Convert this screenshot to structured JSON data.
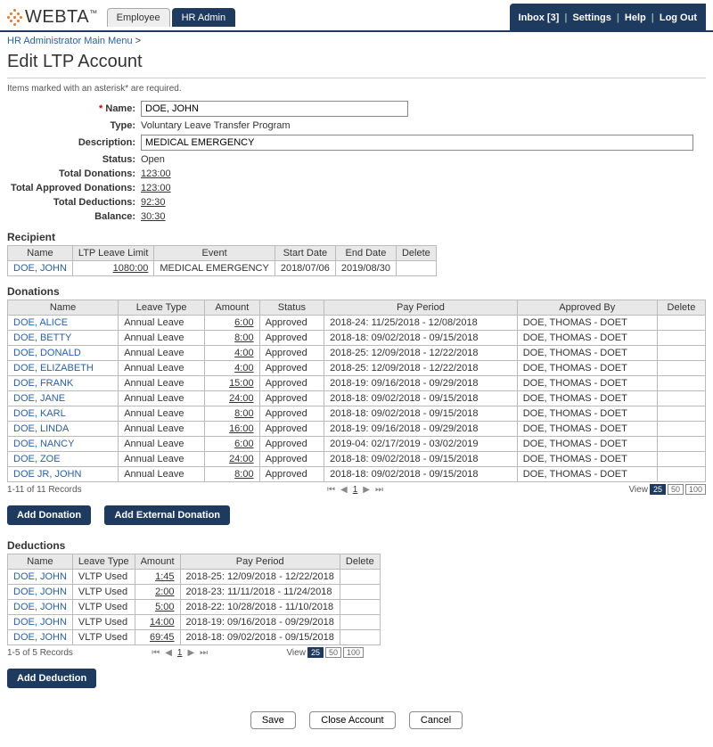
{
  "header": {
    "logo_text": "WEBTA",
    "logo_tm": "™",
    "tabs": [
      "Employee",
      "HR Admin"
    ],
    "active_tab": 1,
    "links": {
      "inbox": "Inbox [3]",
      "settings": "Settings",
      "help": "Help",
      "logout": "Log Out"
    }
  },
  "breadcrumb": {
    "items": [
      "HR Administrator Main Menu"
    ],
    "sep": ">"
  },
  "page_title": "Edit LTP Account",
  "required_note": "Items marked with an asterisk* are required.",
  "form": {
    "name_label": "Name:",
    "name_value": "DOE, JOHN",
    "type_label": "Type:",
    "type_value": "Voluntary Leave Transfer Program",
    "desc_label": "Description:",
    "desc_value": "MEDICAL EMERGENCY",
    "status_label": "Status:",
    "status_value": "Open",
    "total_donations_label": "Total Donations:",
    "total_donations_value": "123:00",
    "total_approved_label": "Total Approved Donations:",
    "total_approved_value": "123:00",
    "total_deductions_label": "Total Deductions:",
    "total_deductions_value": "92:30",
    "balance_label": "Balance:",
    "balance_value": "30:30"
  },
  "recipient": {
    "title": "Recipient",
    "headers": [
      "Name",
      "LTP Leave Limit",
      "Event",
      "Start Date",
      "End Date",
      "Delete"
    ],
    "rows": [
      {
        "name": "DOE, JOHN",
        "limit": "1080:00",
        "event": "MEDICAL EMERGENCY",
        "start": "2018/07/06",
        "end": "2019/08/30"
      }
    ]
  },
  "donations": {
    "title": "Donations",
    "headers": [
      "Name",
      "Leave Type",
      "Amount",
      "Status",
      "Pay Period",
      "Approved By",
      "Delete"
    ],
    "rows": [
      {
        "name": "DOE, ALICE",
        "type": "Annual Leave",
        "amount": "6:00",
        "status": "Approved",
        "period": "2018-24: 11/25/2018 - 12/08/2018",
        "by": "DOE, THOMAS - DOET"
      },
      {
        "name": "DOE, BETTY",
        "type": "Annual Leave",
        "amount": "8:00",
        "status": "Approved",
        "period": "2018-18: 09/02/2018 - 09/15/2018",
        "by": "DOE, THOMAS - DOET"
      },
      {
        "name": "DOE, DONALD",
        "type": "Annual Leave",
        "amount": "4:00",
        "status": "Approved",
        "period": "2018-25: 12/09/2018 - 12/22/2018",
        "by": "DOE, THOMAS - DOET"
      },
      {
        "name": "DOE, ELIZABETH",
        "type": "Annual Leave",
        "amount": "4:00",
        "status": "Approved",
        "period": "2018-25: 12/09/2018 - 12/22/2018",
        "by": "DOE, THOMAS - DOET"
      },
      {
        "name": "DOE, FRANK",
        "type": "Annual Leave",
        "amount": "15:00",
        "status": "Approved",
        "period": "2018-19: 09/16/2018 - 09/29/2018",
        "by": "DOE, THOMAS - DOET"
      },
      {
        "name": "DOE, JANE",
        "type": "Annual Leave",
        "amount": "24:00",
        "status": "Approved",
        "period": "2018-18: 09/02/2018 - 09/15/2018",
        "by": "DOE, THOMAS - DOET"
      },
      {
        "name": "DOE, KARL",
        "type": "Annual Leave",
        "amount": "8:00",
        "status": "Approved",
        "period": "2018-18: 09/02/2018 - 09/15/2018",
        "by": "DOE, THOMAS - DOET"
      },
      {
        "name": "DOE, LINDA",
        "type": "Annual Leave",
        "amount": "16:00",
        "status": "Approved",
        "period": "2018-19: 09/16/2018 - 09/29/2018",
        "by": "DOE, THOMAS - DOET"
      },
      {
        "name": "DOE, NANCY",
        "type": "Annual Leave",
        "amount": "6:00",
        "status": "Approved",
        "period": "2019-04: 02/17/2019 - 03/02/2019",
        "by": "DOE, THOMAS - DOET"
      },
      {
        "name": "DOE, ZOE",
        "type": "Annual Leave",
        "amount": "24:00",
        "status": "Approved",
        "period": "2018-18: 09/02/2018 - 09/15/2018",
        "by": "DOE, THOMAS - DOET"
      },
      {
        "name": "DOE JR, JOHN",
        "type": "Annual Leave",
        "amount": "8:00",
        "status": "Approved",
        "period": "2018-18: 09/02/2018 - 09/15/2018",
        "by": "DOE, THOMAS - DOET"
      }
    ],
    "footer_count": "1-11 of 11 Records",
    "view_label": "View",
    "view_options": [
      "25",
      "50",
      "100"
    ],
    "add_donation": "Add Donation",
    "add_external": "Add External Donation"
  },
  "deductions": {
    "title": "Deductions",
    "headers": [
      "Name",
      "Leave Type",
      "Amount",
      "Pay Period",
      "Delete"
    ],
    "rows": [
      {
        "name": "DOE, JOHN",
        "type": "VLTP Used",
        "amount": "1:45",
        "period": "2018-25: 12/09/2018 - 12/22/2018"
      },
      {
        "name": "DOE, JOHN",
        "type": "VLTP Used",
        "amount": "2:00",
        "period": "2018-23: 11/11/2018 - 11/24/2018"
      },
      {
        "name": "DOE, JOHN",
        "type": "VLTP Used",
        "amount": "5:00",
        "period": "2018-22: 10/28/2018 - 11/10/2018"
      },
      {
        "name": "DOE, JOHN",
        "type": "VLTP Used",
        "amount": "14:00",
        "period": "2018-19: 09/16/2018 - 09/29/2018"
      },
      {
        "name": "DOE, JOHN",
        "type": "VLTP Used",
        "amount": "69:45",
        "period": "2018-18: 09/02/2018 - 09/15/2018"
      }
    ],
    "footer_count": "1-5 of 5 Records",
    "view_label": "View",
    "view_options": [
      "25",
      "50",
      "100"
    ],
    "add_deduction": "Add Deduction"
  },
  "actions": {
    "save": "Save",
    "close": "Close Account",
    "cancel": "Cancel"
  },
  "pager": {
    "page": "1"
  }
}
